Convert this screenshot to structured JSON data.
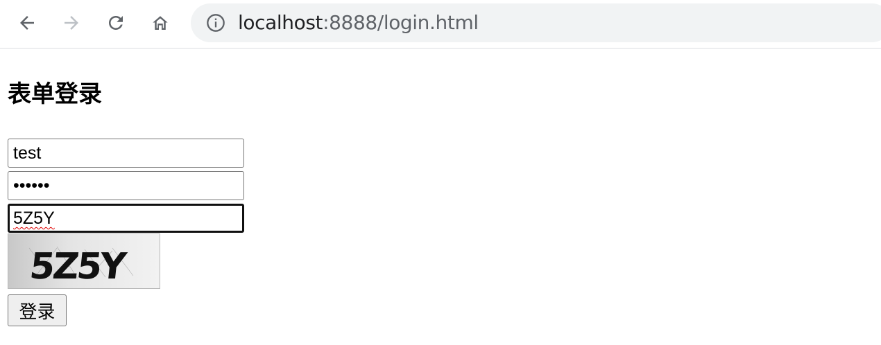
{
  "browser": {
    "back_icon": "arrow-left-icon",
    "forward_icon": "arrow-right-icon",
    "reload_icon": "reload-icon",
    "home_icon": "home-icon",
    "site_info_icon": "info-circle-icon",
    "url_host": "localhost",
    "url_path": ":8888/login.html",
    "forward_enabled": false
  },
  "page": {
    "title": "表单登录"
  },
  "form": {
    "username_value": "test",
    "password_value": "••••••",
    "captcha_value": "5Z5Y",
    "captcha_image_text": "5Z5Y",
    "submit_label": "登录"
  },
  "colors": {
    "icon": "#5f6368",
    "icon_disabled": "#bdc1c6",
    "omnibox": "#f1f3f4",
    "focus_border": "#101010",
    "spellcheck": "#e00000"
  }
}
